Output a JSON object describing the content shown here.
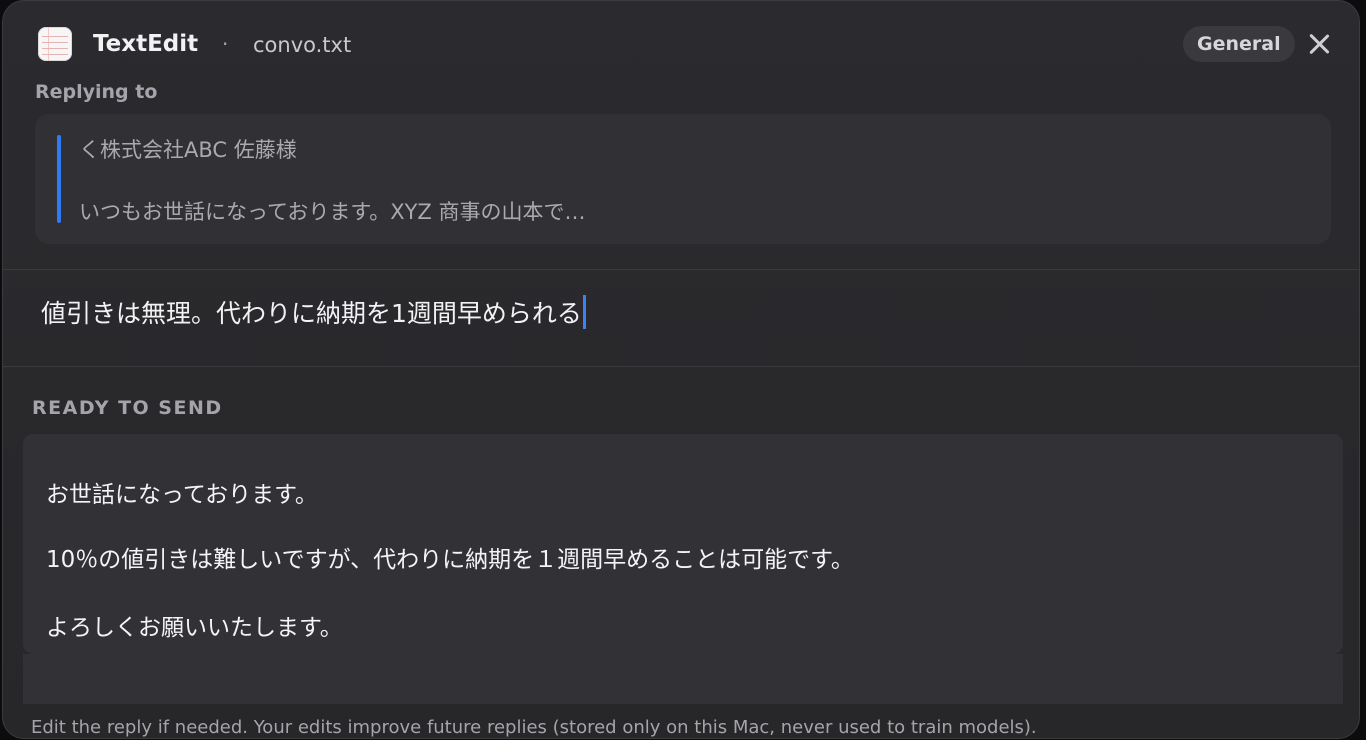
{
  "header": {
    "app_name": "TextEdit",
    "separator": "·",
    "file_name": "convo.txt",
    "tag": "General",
    "close_icon": "close-icon"
  },
  "replying": {
    "label": "Replying to",
    "subject": "く株式会社ABC 佐藤様",
    "snippet": "いつもお世話になっております。XYZ 商事の山本で…"
  },
  "input": {
    "value": "値引きは無理。代わりに納期を1週間早められる"
  },
  "ready": {
    "label": "READY TO SEND",
    "lines": [
      "お世話になっております。",
      "10％の値引きは難しいですが、代わりに納期を１週間早めることは可能です。",
      "よろしくお願いいたします。"
    ]
  },
  "footer": {
    "text": "Edit the reply if needed. Your edits improve future replies (stored only on this Mac, never used to train models)."
  },
  "colors": {
    "accent": "#2f7bf6",
    "window_bg": "#2b2b2f",
    "panel_bg": "#323236"
  }
}
